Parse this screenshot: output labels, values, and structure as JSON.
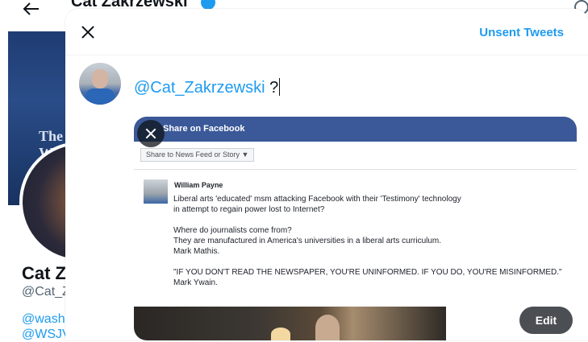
{
  "background": {
    "header_name": "Cat Zakrzewski",
    "banner_text": "The Wa",
    "banner_subtext": "The Washington Post",
    "display_name": "Cat Z",
    "handle": "@Cat_Z",
    "link1": "@wash",
    "link2": "@WSJV"
  },
  "modal": {
    "unsent_tweets": "Unsent Tweets",
    "composer": {
      "mention": "@Cat_Zakrzewski",
      "text_after_mention": " ?"
    },
    "attachment": {
      "dialog_title": "Share on Facebook",
      "share_select": "Share to News Feed or Story ▼",
      "post_author": "William Payne",
      "post_lines": [
        "Liberal arts 'educated' msm attacking Facebook with their 'Testimony' technology",
        "in attempt to regain power lost to Internet?",
        "",
        "Where do journalists come from?",
        "They are manufactured in America's universities in a liberal arts curriculum.",
        "Mark Mathis.",
        "",
        "\"IF YOU DON'T READ THE NEWSPAPER, YOU'RE UNINFORMED. IF YOU DO, YOU'RE MISINFORMED.\"",
        "Mark Ywain."
      ],
      "edit_label": "Edit"
    }
  },
  "colors": {
    "accent": "#1d9bf0",
    "facebook_blue": "#3b5998"
  },
  "icons": [
    "back-arrow-icon",
    "verified-badge-icon",
    "search-icon",
    "close-icon",
    "remove-media-icon"
  ]
}
